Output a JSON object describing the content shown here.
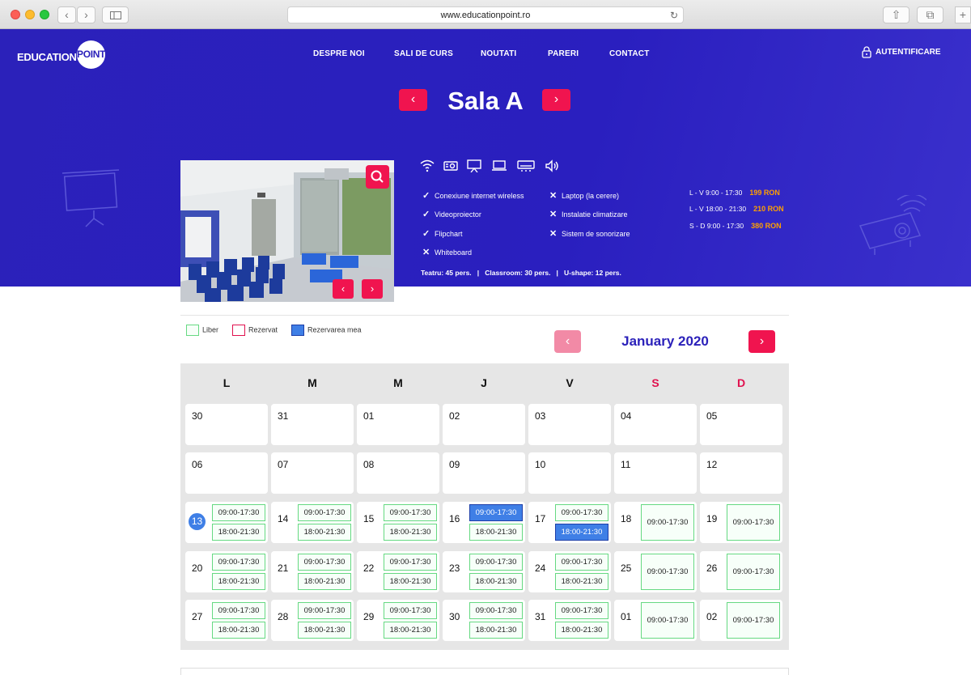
{
  "browser": {
    "url": "www.educationpoint.ro"
  },
  "logo": {
    "text": "EDUCATION",
    "circle": "POINT"
  },
  "nav": [
    "DESPRE NOI",
    "SALI DE CURS",
    "NOUTATI",
    "PARERI",
    "CONTACT"
  ],
  "auth": "AUTENTIFICARE",
  "room": {
    "title": "Sala A",
    "prev": "‹",
    "next": "›"
  },
  "amenities": [
    "wifi-icon",
    "projector-icon",
    "flipchart-icon",
    "laptop-icon",
    "ac-icon",
    "speaker-icon"
  ],
  "features": [
    {
      "label": "Conexiune internet wireless",
      "available": true
    },
    {
      "label": "Videoproiector",
      "available": true
    },
    {
      "label": "Flipchart",
      "available": true
    },
    {
      "label": "Whiteboard",
      "available": false
    },
    {
      "label": "Laptop (la cerere)",
      "available": false
    },
    {
      "label": "Instalatie climatizare",
      "available": false
    },
    {
      "label": "Sistem de sonorizare",
      "available": false
    }
  ],
  "capacity": "Teatru: 45 pers.   |   Classroom: 30 pers.   |   U-shape: 12 pers.",
  "prices": [
    {
      "label": "L - V 9:00 - 17:30",
      "price": "199 RON"
    },
    {
      "label": "L - V 18:00 - 21:30",
      "price": "210 RON"
    },
    {
      "label": "S - D 9:00 - 17:30",
      "price": "380 RON"
    }
  ],
  "legend": [
    {
      "label": "Liber",
      "color": "#66d982"
    },
    {
      "label": "Rezervat",
      "color": "#e0114e"
    },
    {
      "label": "Rezervarea mea",
      "color": "#3f7fe6"
    }
  ],
  "calendar": {
    "month": "January 2020",
    "prev": "‹",
    "next": "›",
    "weekdays": [
      "L",
      "M",
      "M",
      "J",
      "V",
      "S",
      "D"
    ],
    "weeks": [
      [
        {
          "d": "30"
        },
        {
          "d": "31"
        },
        {
          "d": "01"
        },
        {
          "d": "02"
        },
        {
          "d": "03"
        },
        {
          "d": "04"
        },
        {
          "d": "05"
        }
      ],
      [
        {
          "d": "06"
        },
        {
          "d": "07"
        },
        {
          "d": "08"
        },
        {
          "d": "09"
        },
        {
          "d": "10"
        },
        {
          "d": "11"
        },
        {
          "d": "12"
        }
      ],
      [
        {
          "d": "13",
          "today": true,
          "slots": [
            {
              "t": "09:00-17:30"
            },
            {
              "t": "18:00-21:30"
            }
          ]
        },
        {
          "d": "14",
          "slots": [
            {
              "t": "09:00-17:30"
            },
            {
              "t": "18:00-21:30"
            }
          ]
        },
        {
          "d": "15",
          "slots": [
            {
              "t": "09:00-17:30"
            },
            {
              "t": "18:00-21:30"
            }
          ]
        },
        {
          "d": "16",
          "slots": [
            {
              "t": "09:00-17:30",
              "mine": true
            },
            {
              "t": "18:00-21:30"
            }
          ]
        },
        {
          "d": "17",
          "slots": [
            {
              "t": "09:00-17:30"
            },
            {
              "t": "18:00-21:30",
              "mine": true
            }
          ]
        },
        {
          "d": "18",
          "slots": [
            {
              "t": "09:00-17:30"
            }
          ]
        },
        {
          "d": "19",
          "slots": [
            {
              "t": "09:00-17:30"
            }
          ]
        }
      ],
      [
        {
          "d": "20",
          "slots": [
            {
              "t": "09:00-17:30"
            },
            {
              "t": "18:00-21:30"
            }
          ]
        },
        {
          "d": "21",
          "slots": [
            {
              "t": "09:00-17:30"
            },
            {
              "t": "18:00-21:30"
            }
          ]
        },
        {
          "d": "22",
          "slots": [
            {
              "t": "09:00-17:30"
            },
            {
              "t": "18:00-21:30"
            }
          ]
        },
        {
          "d": "23",
          "slots": [
            {
              "t": "09:00-17:30"
            },
            {
              "t": "18:00-21:30"
            }
          ]
        },
        {
          "d": "24",
          "slots": [
            {
              "t": "09:00-17:30"
            },
            {
              "t": "18:00-21:30"
            }
          ]
        },
        {
          "d": "25",
          "slots": [
            {
              "t": "09:00-17:30"
            }
          ]
        },
        {
          "d": "26",
          "slots": [
            {
              "t": "09:00-17:30"
            }
          ]
        }
      ],
      [
        {
          "d": "27",
          "slots": [
            {
              "t": "09:00-17:30"
            },
            {
              "t": "18:00-21:30"
            }
          ]
        },
        {
          "d": "28",
          "slots": [
            {
              "t": "09:00-17:30"
            },
            {
              "t": "18:00-21:30"
            }
          ]
        },
        {
          "d": "29",
          "slots": [
            {
              "t": "09:00-17:30"
            },
            {
              "t": "18:00-21:30"
            }
          ]
        },
        {
          "d": "30",
          "slots": [
            {
              "t": "09:00-17:30"
            },
            {
              "t": "18:00-21:30"
            }
          ]
        },
        {
          "d": "31",
          "slots": [
            {
              "t": "09:00-17:30"
            },
            {
              "t": "18:00-21:30"
            }
          ]
        },
        {
          "d": "01",
          "slots": [
            {
              "t": "09:00-17:30"
            }
          ]
        },
        {
          "d": "02",
          "slots": [
            {
              "t": "09:00-17:30"
            }
          ]
        }
      ]
    ]
  }
}
